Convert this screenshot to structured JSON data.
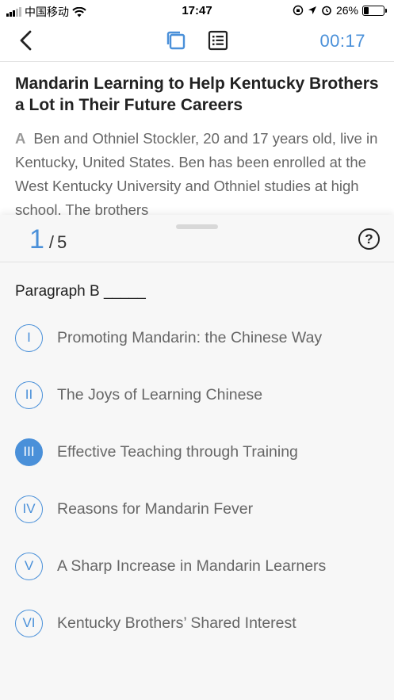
{
  "status_bar": {
    "carrier": "中国移动",
    "time": "17:47",
    "battery": "26%",
    "battery_level": 0.26
  },
  "nav": {
    "timer": "00:17",
    "back_icon": "chevron-left-icon",
    "copy_icon": "copy-icon",
    "list_icon": "list-icon",
    "accent_color": "#4a90d9"
  },
  "article": {
    "title": "Mandarin Learning to Help Kentucky Brothers a Lot in Their Future Careers",
    "paragraph_label": "A",
    "paragraph_text": "Ben and Othniel Stockler, 20 and 17 years old, live in Kentucky, United States. Ben has been enrolled at the West Kentucky University and Othniel studies at high school. The brothers"
  },
  "question_panel": {
    "current": "1",
    "separator": "/",
    "total": "5",
    "help_icon": "?",
    "question": "Paragraph B _____",
    "options": [
      {
        "numeral": "I",
        "text": "Promoting Mandarin: the Chinese Way",
        "selected": false
      },
      {
        "numeral": "II",
        "text": "The Joys of Learning Chinese",
        "selected": false
      },
      {
        "numeral": "III",
        "text": "Effective Teaching through Training",
        "selected": true
      },
      {
        "numeral": "IV",
        "text": "Reasons for Mandarin Fever",
        "selected": false
      },
      {
        "numeral": "V",
        "text": "A Sharp Increase in Mandarin Learners",
        "selected": false
      },
      {
        "numeral": "VI",
        "text": "Kentucky Brothers’ Shared Interest",
        "selected": false
      }
    ]
  }
}
